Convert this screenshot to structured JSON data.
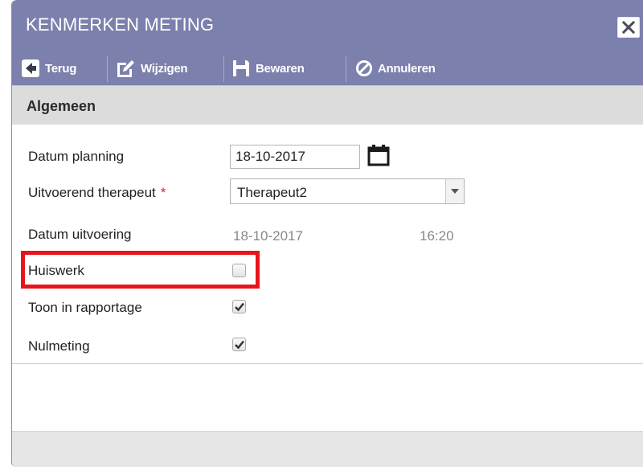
{
  "dialog": {
    "title": "KENMERKEN METING",
    "close_icon": "close-icon"
  },
  "toolbar": {
    "back_label": "Terug",
    "edit_label": "Wijzigen",
    "save_label": "Bewaren",
    "cancel_label": "Annuleren"
  },
  "section": {
    "title": "Algemeen"
  },
  "form": {
    "datum_planning_label": "Datum planning",
    "datum_planning_value": "18-10-2017",
    "therapeut_label": "Uitvoerend therapeut",
    "required_marker": "*",
    "therapeut_value": "Therapeut2",
    "datum_uitvoering_label": "Datum uitvoering",
    "datum_uitvoering_date": "18-10-2017",
    "datum_uitvoering_time": "16:20",
    "huiswerk_label": "Huiswerk",
    "huiswerk_checked": false,
    "rapportage_label": "Toon in rapportage",
    "rapportage_checked": true,
    "nulmeting_label": "Nulmeting",
    "nulmeting_checked": true
  },
  "colors": {
    "titlebar": "#7c80ad",
    "highlight": "#e8141c",
    "required": "#d8232a"
  }
}
